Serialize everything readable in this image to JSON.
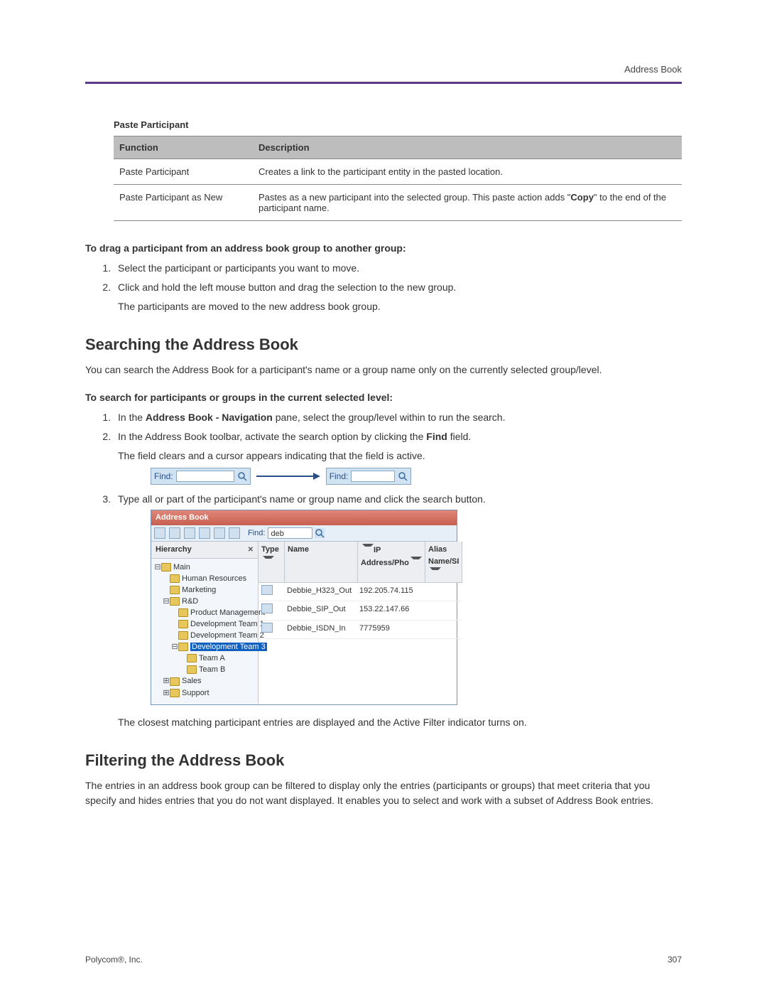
{
  "header": {
    "running_head": "Address Book"
  },
  "table": {
    "caption": "Paste Participant",
    "cols": {
      "function": "Function",
      "description": "Description"
    },
    "rows": [
      {
        "func": "Paste Participant",
        "desc": "Creates a link to the participant entity in the pasted location."
      },
      {
        "func": "Paste Participant as New",
        "desc_pre": "Pastes as a new participant into the selected group. This paste action adds \"",
        "desc_bold": "Copy",
        "desc_post": "\" to the end of the participant name."
      }
    ]
  },
  "drag": {
    "heading": "To drag a participant from an address book group to another group:",
    "steps": [
      "Select the participant or participants you want to move.",
      "Click and hold the left mouse button and drag the selection to the new group."
    ],
    "after2": "The participants are moved to the new address book group."
  },
  "search": {
    "h2": "Searching the Address Book",
    "intro": "You can search the Address Book for a participant's name or a group name only on the currently selected group/level.",
    "subheading": "To search for participants or groups in the current selected level:",
    "step1_pre": "In the ",
    "step1_bold": "Address Book - Navigation",
    "step1_post": " pane, select the group/level within to run the search.",
    "step2_pre": "In the Address Book toolbar, activate the search option by clicking the ",
    "step2_bold": "Find",
    "step2_post": " field.",
    "step2_after": "The field clears and a cursor appears indicating that the field is active.",
    "find_label": "Find:",
    "step3": "Type all or part of the participant's name or group name and click the search button.",
    "result": "The closest matching participant entries are displayed and the Active Filter indicator turns on."
  },
  "ab": {
    "title": "Address Book",
    "find_label": "Find:",
    "find_value": "deb",
    "nav_head": "Hierarchy",
    "tree": {
      "main": "Main",
      "hr": "Human Resources",
      "marketing": "Marketing",
      "rd": "R&D",
      "pm": "Product Management",
      "dev1": "Development Team 1",
      "dev2": "Development Team 2",
      "dev3": "Development Team 3",
      "teamA": "Team A",
      "teamB": "Team B",
      "sales": "Sales",
      "support": "Support"
    },
    "cols": {
      "type": "Type",
      "name": "Name",
      "ip": "IP Address/Pho",
      "alias": "Alias Name/SI"
    },
    "rows": [
      {
        "name": "Debbie_H323_Out",
        "ip": "192.205.74.115"
      },
      {
        "name": "Debbie_SIP_Out",
        "ip": "153.22.147.66"
      },
      {
        "name": "Debbie_ISDN_In",
        "ip": "7775959"
      }
    ]
  },
  "filter": {
    "h2": "Filtering the Address Book",
    "intro": "The entries in an address book group can be filtered to display only the entries (participants or groups) that meet criteria that you specify and hides entries that you do not want displayed. It enables you to select and work with a subset of Address Book entries."
  },
  "footer": {
    "left": "Polycom®, Inc.",
    "right": "307"
  }
}
